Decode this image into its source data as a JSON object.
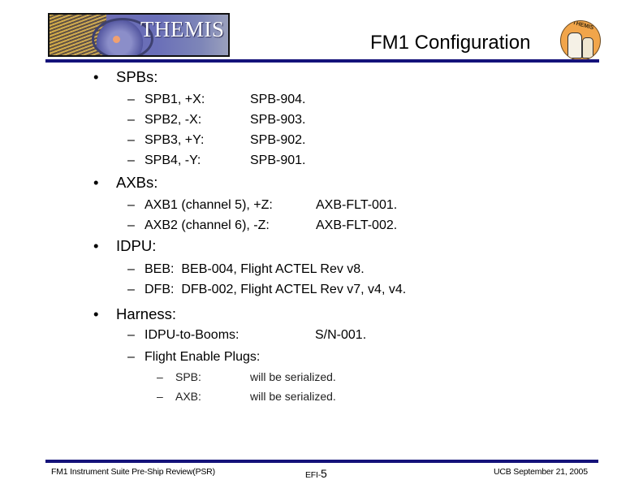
{
  "header": {
    "banner_text": "THEMIS",
    "slide_title": "FM1 Configuration",
    "logo_text": "THEMIS"
  },
  "sections": [
    {
      "heading": "SPBs:",
      "items": [
        {
          "label": "SPB1, +X:",
          "value": "SPB-904."
        },
        {
          "label": "SPB2, -X:",
          "value": "SPB-903."
        },
        {
          "label": "SPB3, +Y:",
          "value": "SPB-902."
        },
        {
          "label": "SPB4, -Y:",
          "value": "SPB-901."
        }
      ]
    },
    {
      "heading": "AXBs:",
      "items": [
        {
          "label": "AXB1 (channel 5), +Z:",
          "value": "AXB-FLT-001."
        },
        {
          "label": "AXB2 (channel 6), -Z:",
          "value": "AXB-FLT-002."
        }
      ]
    },
    {
      "heading": "IDPU:",
      "items": [
        {
          "label": "BEB:  BEB-004, Flight ACTEL Rev v8."
        },
        {
          "label": "DFB:  DFB-002, Flight ACTEL Rev v7, v4, v4."
        }
      ]
    },
    {
      "heading": "Harness:",
      "items": [
        {
          "label": "IDPU-to-Booms:",
          "value": "S/N-001."
        },
        {
          "label": "Flight Enable Plugs:",
          "subitems": [
            {
              "label": "SPB:",
              "value": "will be serialized."
            },
            {
              "label": "AXB:",
              "value": "will be serialized."
            }
          ]
        }
      ]
    }
  ],
  "bullet_glyph": "•",
  "dash_glyph": "–",
  "footer": {
    "left": "FM1 Instrument Suite Pre-Ship Review(PSR)",
    "center_prefix": "EFI-",
    "center_number": "5",
    "right": "UCB September 21, 2005"
  }
}
